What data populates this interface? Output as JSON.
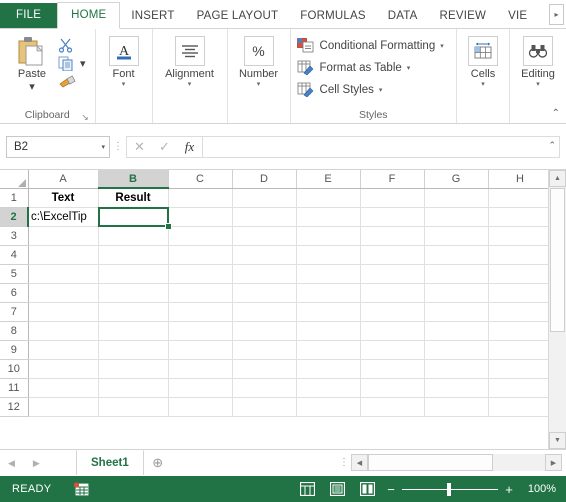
{
  "colors": {
    "excel_green": "#217346",
    "selection_green": "#217346",
    "tab_active_text": "#217346",
    "ribbon_text": "#444444"
  },
  "tabstrip": {
    "file_label": "FILE",
    "tabs": [
      {
        "label": "HOME",
        "active": true
      },
      {
        "label": "INSERT",
        "active": false
      },
      {
        "label": "PAGE LAYOUT",
        "active": false
      },
      {
        "label": "FORMULAS",
        "active": false
      },
      {
        "label": "DATA",
        "active": false
      },
      {
        "label": "REVIEW",
        "active": false
      },
      {
        "label": "VIE",
        "active": false
      }
    ],
    "overflow_icon": "▸"
  },
  "ribbon": {
    "collapse_icon": "⌃",
    "groups": [
      {
        "name": "clipboard",
        "label": "Clipboard",
        "launcher": "↘",
        "paste_label": "Paste",
        "paste_arrow": "▾",
        "items": [
          {
            "icon": "cut-icon",
            "label": "Cut"
          },
          {
            "icon": "copy-icon",
            "label": "Copy"
          },
          {
            "icon": "format-painter-icon",
            "label": "Format Painter"
          }
        ]
      },
      {
        "name": "font",
        "label": "Font",
        "button_label": "Font",
        "arrow": "▾"
      },
      {
        "name": "alignment",
        "label": "Alignment",
        "button_label": "Alignment",
        "arrow": "▾"
      },
      {
        "name": "number",
        "label": "Number",
        "button_label": "Number",
        "icon_glyph": "%",
        "arrow": "▾"
      },
      {
        "name": "styles",
        "label": "Styles",
        "rows": [
          {
            "label": "Conditional Formatting",
            "caret": "▾"
          },
          {
            "label": "Format as Table",
            "caret": "▾"
          },
          {
            "label": "Cell Styles",
            "caret": "▾"
          }
        ]
      },
      {
        "name": "cells",
        "label": "Cells",
        "button_label": "Cells",
        "arrow": "▾"
      },
      {
        "name": "editing",
        "label": "Editing",
        "button_label": "Editing",
        "arrow": "▾"
      }
    ]
  },
  "formula_bar": {
    "name_box_value": "B2",
    "name_box_caret": "▾",
    "dots": "⋮",
    "cancel_icon": "✕",
    "enter_icon": "✓",
    "fx_label": "fx",
    "value": "",
    "placeholder": "",
    "expand_icon": "⌃"
  },
  "grid": {
    "columns": [
      "A",
      "B",
      "C",
      "D",
      "E",
      "F",
      "G",
      "H"
    ],
    "selected_column": "B",
    "rows": [
      1,
      2,
      3,
      4,
      5,
      6,
      7,
      8,
      9,
      10,
      11,
      12
    ],
    "selected_row": 2,
    "active_cell": "B2",
    "cells": {
      "A1": {
        "value": "Text",
        "style": "header"
      },
      "B1": {
        "value": "Result",
        "style": "header"
      },
      "A2": {
        "value": "c:\\ExcelTip",
        "style": "text"
      }
    },
    "vscroll": {
      "up_icon": "▲",
      "down_icon": "▼"
    }
  },
  "sheetbar": {
    "prev_icon": "◀",
    "next_icon": "▶",
    "tabs": [
      {
        "label": "Sheet1",
        "active": true
      }
    ],
    "add_sheet_icon": "⊕",
    "dots": "⋮",
    "hscroll": {
      "left_icon": "◀",
      "right_icon": "▶"
    }
  },
  "statusbar": {
    "status_text": "READY",
    "macro_record_icon": "macro-record-icon",
    "views": [
      {
        "name": "normal-view",
        "label": "Normal"
      },
      {
        "name": "page-layout-view",
        "label": "Page Layout"
      },
      {
        "name": "page-break-preview",
        "label": "Page Break Preview"
      }
    ],
    "zoom_minus": "−",
    "zoom_plus": "+",
    "zoom_level": "100%"
  }
}
